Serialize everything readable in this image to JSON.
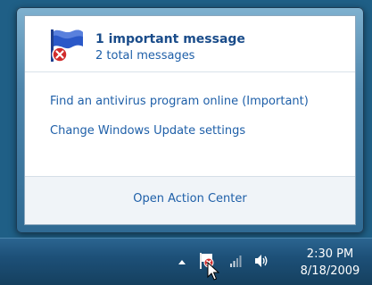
{
  "notification": {
    "important_text": "1 important message",
    "total_text": "2 total messages",
    "links": [
      "Find an antivirus program online (Important)",
      "Change Windows Update settings"
    ],
    "footer_link": "Open Action Center"
  },
  "taskbar": {
    "time": "2:30 PM",
    "date": "8/18/2009",
    "tray_icons": [
      "show-hidden-icons-arrow",
      "action-center-flag-icon",
      "network-signal-icon",
      "volume-icon"
    ]
  },
  "colors": {
    "link": "#1e5fa8",
    "heading": "#1a4c8a",
    "taskbar": "#1d5078"
  }
}
